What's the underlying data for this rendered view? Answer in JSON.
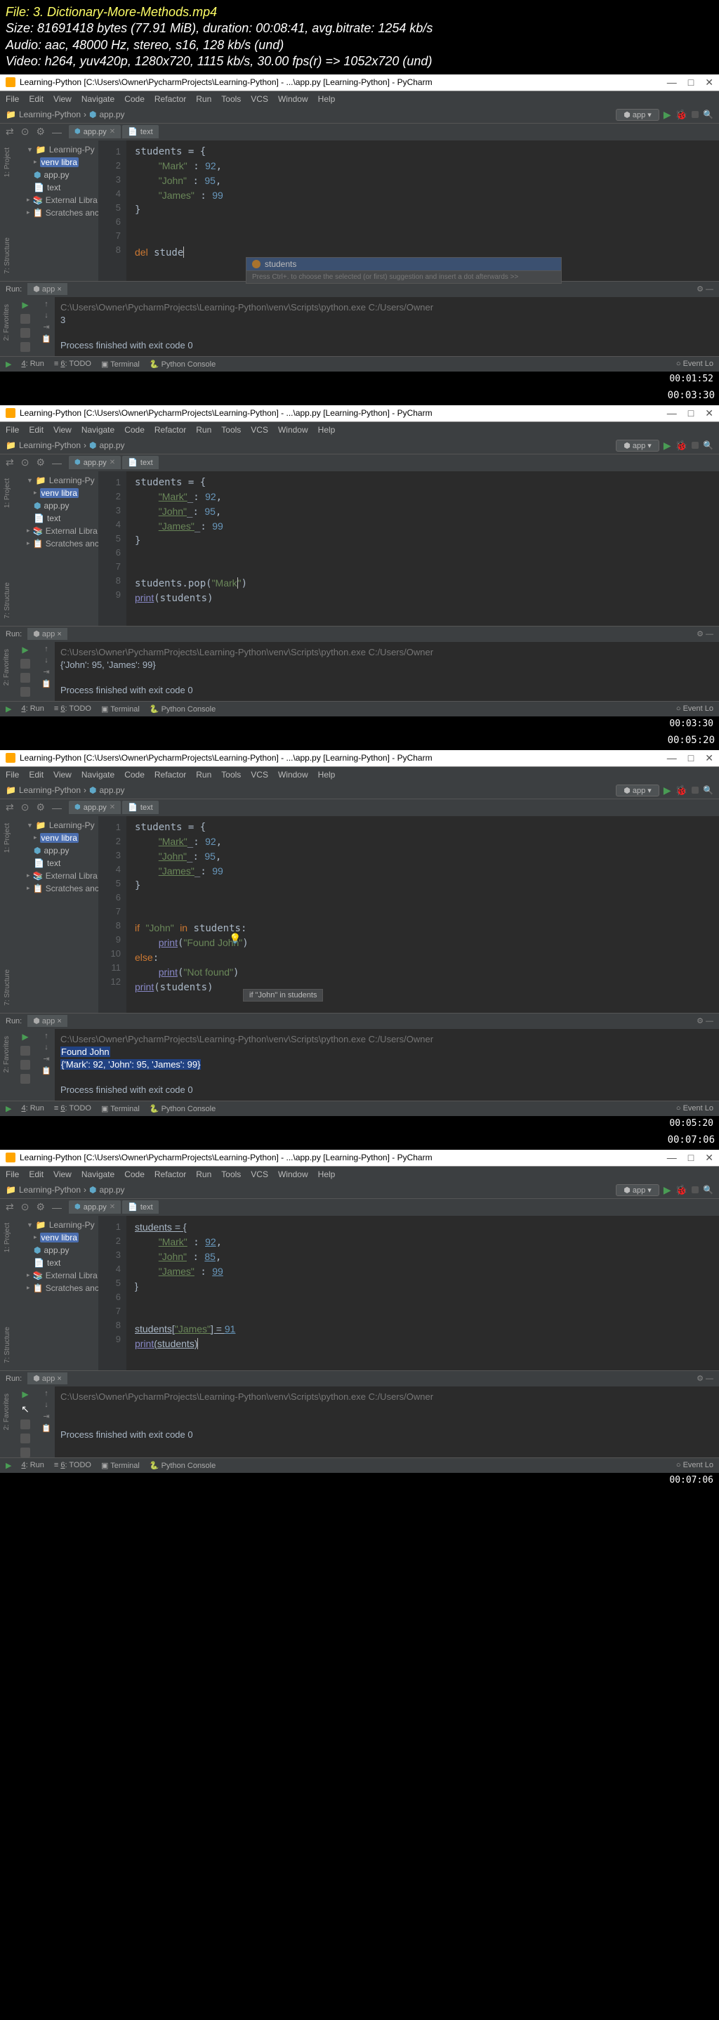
{
  "video_info": {
    "file": "File: 3. Dictionary-More-Methods.mp4",
    "size": "Size: 81691418 bytes (77.91 MiB), duration: 00:08:41, avg.bitrate: 1254 kb/s",
    "audio": "Audio: aac, 48000 Hz, stereo, s16, 128 kb/s (und)",
    "video": "Video: h264, yuv420p, 1280x720, 1115 kb/s, 30.00 fps(r) => 1052x720 (und)"
  },
  "title": "Learning-Python [C:\\Users\\Owner\\PycharmProjects\\Learning-Python] - ...\\app.py [Learning-Python] - PyCharm",
  "menu": [
    "File",
    "Edit",
    "View",
    "Navigate",
    "Code",
    "Refactor",
    "Run",
    "Tools",
    "VCS",
    "Window",
    "Help"
  ],
  "breadcrumb": {
    "a": "Learning-Python",
    "b": "app.py"
  },
  "run_cfg": "app",
  "tabs": {
    "a": "app.py",
    "b": "text"
  },
  "tree": {
    "root": "Learning-Py",
    "venv": "venv libra",
    "app": "app.py",
    "text": "text",
    "ext": "External Libra",
    "scratch": "Scratches anc"
  },
  "statusbar": {
    "run": "4: Run",
    "todo": "6: TODO",
    "term": "Terminal",
    "pycon": "Python Console",
    "evt": "Event Lo"
  },
  "run_header": {
    "run": "Run:",
    "app": "app"
  },
  "side": {
    "proj": "1: Project",
    "struct": "7: Structure",
    "fav": "2: Favorites"
  },
  "frames": [
    {
      "timestamp": "00:01:52",
      "gutter": [
        1,
        2,
        3,
        4,
        5,
        6,
        7,
        8
      ],
      "code_html": "students = {\n    <span class='str'>\"Mark\"</span> : <span class='num'>92</span>,\n    <span class='str'>\"John\"</span> : <span class='num'>95</span>,\n    <span class='str'>\"James\"</span> : <span class='num'>99</span>\n}\n\n\n<span class='kw'>del</span> stude<span class='caret'></span>",
      "completion": {
        "item": "students",
        "hint": "Press Ctrl+. to choose the selected (or first) suggestion and insert a dot afterwards   >>"
      },
      "console": {
        "cmd": "C:\\Users\\Owner\\PycharmProjects\\Learning-Python\\venv\\Scripts\\python.exe C:/Users/Owner",
        "out": [
          "3",
          "",
          "Process finished with exit code 0"
        ]
      }
    },
    {
      "timestamp": "00:03:30",
      "gutter": [
        1,
        2,
        3,
        4,
        5,
        6,
        7,
        8,
        9
      ],
      "code_html": "students = {\n    <span class='str un'>\"Mark\"</span>_: <span class='num'>92</span>,\n    <span class='str un'>\"John\"</span>_: <span class='num'>95</span>,\n    <span class='str un'>\"James\"</span>_: <span class='num'>99</span>\n}\n\n\nstudents.pop(<span class='str'>\"Mark<span class='caret'></span>\"</span>)\n<span class='bi un'>print</span>(students)",
      "console": {
        "cmd": "C:\\Users\\Owner\\PycharmProjects\\Learning-Python\\venv\\Scripts\\python.exe C:/Users/Owner",
        "out": [
          "{'John': 95, 'James': 99}",
          "",
          "Process finished with exit code 0"
        ]
      }
    },
    {
      "timestamp": "00:05:20",
      "gutter": [
        1,
        2,
        3,
        4,
        5,
        6,
        7,
        8,
        9,
        10,
        11,
        12
      ],
      "code_html": "students = {\n    <span class='str un'>\"Mark\"</span>_: <span class='num'>92</span>,\n    <span class='str un'>\"John\"</span>_: <span class='num'>95</span>,\n    <span class='str un'>\"James\"</span>_: <span class='num'>99</span>\n}\n\n\n<span class='kw'>if</span> <span class='str'>\"John\"</span> <span class='kw'>in</span> students:\n    <span class='bi un'>print</span>(<span class='str'>\"Found John\"</span>)\n<span class='kw'>else</span>:\n    <span class='bi un'>print</span>(<span class='str'>\"Not found\"</span>)\n<span class='bi un'>print</span>(students)",
      "hint_popup": "if \"John\" in students",
      "bulb": true,
      "console": {
        "cmd": "C:\\Users\\Owner\\PycharmProjects\\Learning-Python\\venv\\Scripts\\python.exe C:/Users/Owner",
        "out_hl": [
          "Found John",
          "{'Mark': 92, 'John': 95, 'James': 99}"
        ],
        "out": [
          "",
          "Process finished with exit code 0"
        ]
      }
    },
    {
      "timestamp": "00:07:06",
      "gutter": [
        1,
        2,
        3,
        4,
        5,
        6,
        7,
        8,
        9
      ],
      "code_html": "<span class='un'>students = {</span>\n    <span class='str un'>\"Mark\"</span> : <span class='num un'>92</span>,\n    <span class='str un'>\"John\"</span> : <span class='num un'>85</span>,\n    <span class='str un'>\"James\"</span> : <span class='num un'>99</span>\n<span class='un'>}</span>\n\n\n<span class='un'>students[</span><span class='str un'>\"James\"</span><span class='un'>] = </span><span class='num un'>91</span>\n<span class='bi un'>print</span><span class='un'>(students)</span><span class='caret'></span>",
      "console": {
        "cmd": "C:\\Users\\Owner\\PycharmProjects\\Learning-Python\\venv\\Scripts\\python.exe C:/Users/Owner",
        "out": [
          "",
          "",
          "Process finished with exit code 0"
        ]
      },
      "cursor_in_rail": true
    }
  ]
}
